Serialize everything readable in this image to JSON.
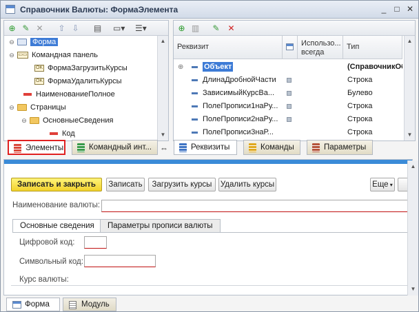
{
  "window": {
    "title": "Справочник Валюты: ФормаЭлемента"
  },
  "tree": {
    "items": [
      {
        "label": "Форма",
        "selected": true
      },
      {
        "label": "Командная панель"
      },
      {
        "label": "ФормаЗагрузитьКурсы"
      },
      {
        "label": "ФормаУдалитьКурсы"
      },
      {
        "label": "НаименованиеПолное"
      },
      {
        "label": "Страницы"
      },
      {
        "label": "ОсновныеСведения"
      },
      {
        "label": "Код"
      }
    ]
  },
  "attributes": {
    "columns": {
      "name": "Реквизит",
      "always": "Использо... всегда",
      "type": "Тип"
    },
    "rows": [
      {
        "name": "Объект",
        "type": "(СправочникОб",
        "checked": false
      },
      {
        "name": "ДлинаДробнойЧасти",
        "type": "Строка",
        "checked": true
      },
      {
        "name": "ЗависимыйКурсВа...",
        "type": "Булево",
        "checked": true
      },
      {
        "name": "ПолеПрописи1наРу...",
        "type": "Строка",
        "checked": true
      },
      {
        "name": "ПолеПрописи2наРу...",
        "type": "Строка",
        "checked": true
      },
      {
        "name": "ПолеПрописи3наР...",
        "type": "Строка",
        "checked": false
      }
    ]
  },
  "left_tabs": [
    {
      "label": "Элементы",
      "icon": "elements-icon"
    },
    {
      "label": "Командный инт...",
      "icon": "command-interface-icon"
    }
  ],
  "right_tabs": [
    {
      "label": "Реквизиты",
      "icon": "attributes-icon"
    },
    {
      "label": "Команды",
      "icon": "commands-icon"
    },
    {
      "label": "Параметры",
      "icon": "parameters-icon"
    }
  ],
  "form_preview": {
    "buttons": {
      "save_close": "Записать и закрыть",
      "save": "Записать",
      "load_rates": "Загрузить курсы",
      "delete_rates": "Удалить курсы",
      "more": "Еще"
    },
    "currency_name_label": "Наименование валюты:",
    "tabs": [
      "Основные сведения",
      "Параметры прописи валюты"
    ],
    "digit_code_label": "Цифровой код:",
    "symbol_code_label": "Символьный код:",
    "rate_label": "Курс валюты:"
  },
  "bottom_tabs": [
    {
      "label": "Форма",
      "icon": "form-icon"
    },
    {
      "label": "Модуль",
      "icon": "module-icon"
    }
  ],
  "colors": {
    "highlight": "#e02020",
    "selection": "#3d7bd6",
    "preview_bar": "#3a8bd8"
  }
}
